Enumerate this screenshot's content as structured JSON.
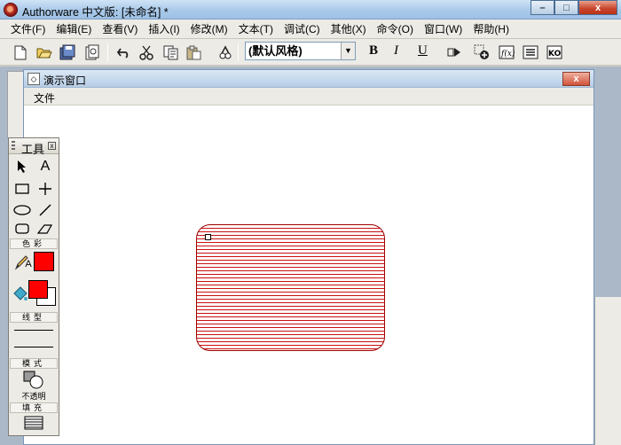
{
  "window": {
    "title": "Authorware 中文版: [未命名] *"
  },
  "window_controls": {
    "minimize": "–",
    "maximize": "□",
    "close": "x"
  },
  "menubar": {
    "items": [
      "文件(F)",
      "编辑(E)",
      "查看(V)",
      "插入(I)",
      "修改(M)",
      "文本(T)",
      "调试(C)",
      "其他(X)",
      "命令(O)",
      "窗口(W)",
      "帮助(H)"
    ]
  },
  "toolbar": {
    "style_select": "(默认风格)",
    "bold": "B",
    "italic": "I",
    "underline": "U"
  },
  "presentation": {
    "title": "演示窗口",
    "close": "x",
    "menu_file": "文件"
  },
  "tools": {
    "title": "工具",
    "close": "x",
    "color_label": "色彩",
    "line_label": "线型",
    "mode_label": "模式",
    "mode_value": "不透明",
    "fill_label": "填充",
    "text_tool": "A",
    "text_color_letter": "A"
  },
  "colors": {
    "shape_stripe": "#c81010",
    "line_color": "#ff0000",
    "fill_foreground": "#ff0000",
    "fill_background": "#ffffff"
  }
}
